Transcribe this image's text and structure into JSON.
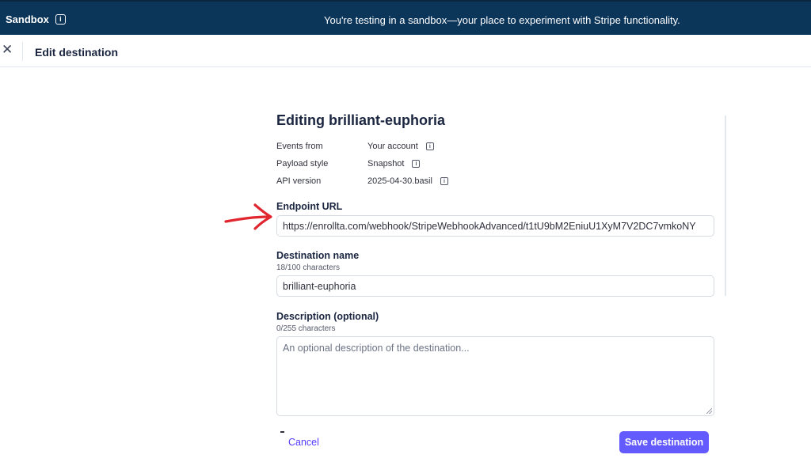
{
  "banner": {
    "sandbox_label": "Sandbox",
    "message": "You're testing in a sandbox—your place to experiment with Stripe functionality."
  },
  "header": {
    "close_icon": "✕",
    "title": "Edit destination"
  },
  "form": {
    "heading": "Editing brilliant-euphoria",
    "meta": [
      {
        "label": "Events from",
        "value": "Your account"
      },
      {
        "label": "Payload style",
        "value": "Snapshot"
      },
      {
        "label": "API version",
        "value": "2025-04-30.basil"
      }
    ],
    "endpoint": {
      "label": "Endpoint URL",
      "value": "https://enrollta.com/webhook/StripeWebhookAdvanced/t1tU9bM2EniuU1XyM7V2DC7vmkoNY"
    },
    "destination_name": {
      "label": "Destination name",
      "counter": "18/100 characters",
      "value": "brilliant-euphoria"
    },
    "description": {
      "label": "Description (optional)",
      "counter": "0/255 characters",
      "placeholder": "An optional description of the destination..."
    }
  },
  "actions": {
    "cancel_label": "Cancel",
    "save_label": "Save destination"
  },
  "colors": {
    "banner_bg": "#0b3559",
    "primary": "#635bff",
    "annotation_arrow": "#e0262e"
  },
  "icons": {
    "info": "info-icon",
    "close": "close-icon",
    "annotation": "red-arrow-icon"
  }
}
